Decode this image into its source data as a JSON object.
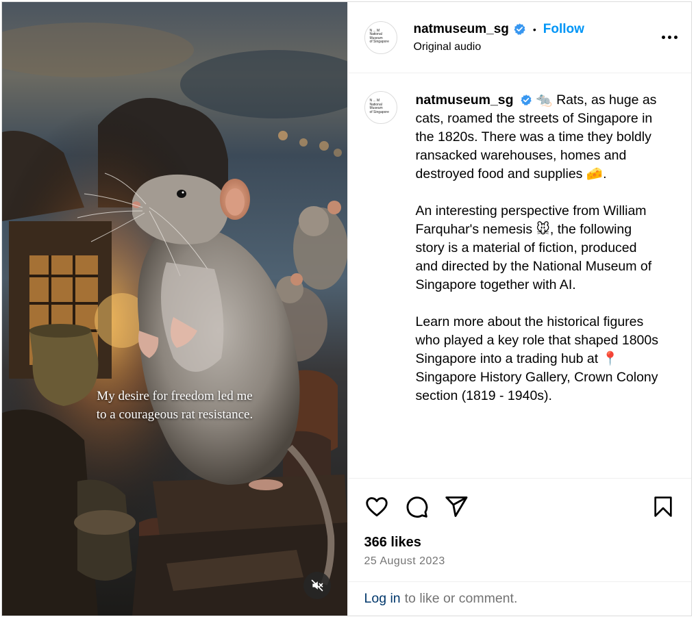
{
  "post": {
    "username": "natmuseum_sg",
    "verified": true,
    "follow_label": "Follow",
    "separator": "•",
    "audio_label": "Original audio",
    "avatar_text": [
      "N ... M",
      "National Museum",
      "of Singapore"
    ],
    "more_icon": "more-horizontal-icon"
  },
  "media": {
    "subtitle_line1": "My desire for freedom led me",
    "subtitle_line2": "to a courageous rat resistance.",
    "mute_icon": "muted-speaker-icon",
    "subject": "rat"
  },
  "caption": {
    "username": "natmuseum_sg",
    "paragraph1": "🐀 Rats, as huge as cats, roamed the streets of Singapore in the 1820s. There was a time they boldly ransacked warehouses, homes and destroyed food and supplies 🧀.",
    "paragraph2": "An interesting perspective from William Farquhar's nemesis 🐭, the following story is a material of fiction, produced and directed by the National Museum of Singapore together with AI.",
    "paragraph3": "Learn more about the historical figures who played a key role that shaped 1800s Singapore into a trading hub at 📍Singapore History Gallery, Crown Colony section (1819 - 1940s)."
  },
  "actions": {
    "icons": [
      "heart-icon",
      "comment-icon",
      "share-icon",
      "bookmark-icon"
    ]
  },
  "likes": "366 likes",
  "date": "25 August 2023",
  "login": {
    "link": "Log in",
    "text": "to like or comment."
  },
  "colors": {
    "link_blue": "#0095f6",
    "verified_blue": "#0095f6",
    "muted_text": "#737373",
    "login_link": "#00376b"
  }
}
